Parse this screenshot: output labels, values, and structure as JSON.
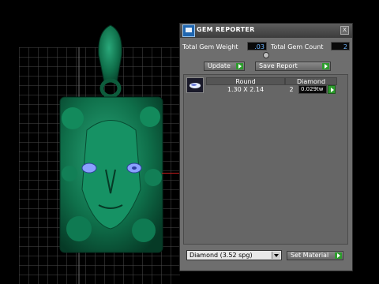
{
  "window": {
    "title": "GEM REPORTER",
    "close_label": "x"
  },
  "summary": {
    "weight_label": "Total Gem Weight",
    "weight_value": ".03",
    "count_label": "Total Gem Count",
    "count_value": "2"
  },
  "toolbar": {
    "update_label": "Update",
    "save_label": "Save Report"
  },
  "table": {
    "headers": [
      "Round",
      "Diamond"
    ],
    "rows": [
      {
        "size": "1.30 X 2.14",
        "count": "2",
        "carat": "0.029tw"
      }
    ]
  },
  "material": {
    "selected": "Diamond   (3.52 spg)",
    "set_label": "Set Material"
  },
  "colors": {
    "model": "#0f6f4a",
    "grid": "#4a4a4a",
    "eyes": "#8aa0ff",
    "accent_green": "#2d9c2d"
  }
}
